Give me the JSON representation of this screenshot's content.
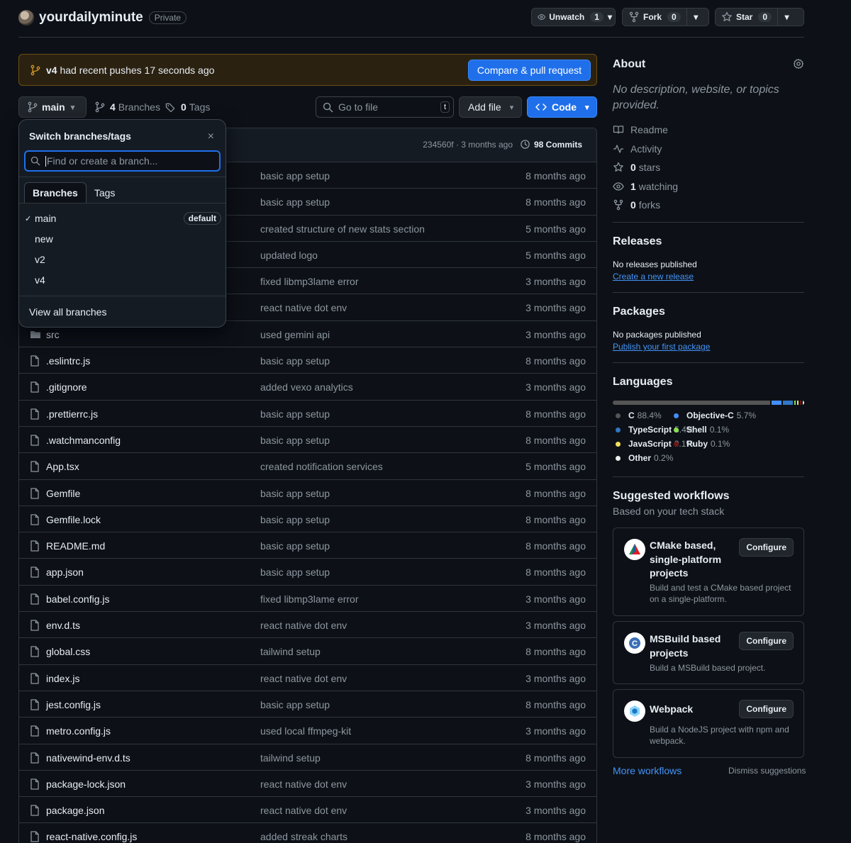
{
  "repo": {
    "owner_name": "yourdailyminute",
    "visibility": "Private"
  },
  "header_actions": {
    "watch": {
      "label": "Unwatch",
      "count": "1"
    },
    "fork": {
      "label": "Fork",
      "count": "0"
    },
    "star": {
      "label": "Star",
      "count": "0"
    }
  },
  "banner": {
    "branch": "v4",
    "text": " had recent pushes 17 seconds ago",
    "button": "Compare & pull request"
  },
  "toolbar": {
    "branch": "main",
    "branches_count": "4",
    "branches_label": "Branches",
    "tags_count": "0",
    "tags_label": "Tags",
    "goto_placeholder": "Go to file",
    "goto_key": "t",
    "add_file": "Add file",
    "code": "Code"
  },
  "latest_commit": {
    "sha_time": "234560f · 3 months ago",
    "commits": "98 Commits"
  },
  "files": [
    {
      "type": "dir",
      "name": "",
      "message": "basic app setup",
      "age": "8 months ago"
    },
    {
      "type": "dir",
      "name": "",
      "message": "basic app setup",
      "age": "8 months ago"
    },
    {
      "type": "dir",
      "name": "",
      "message": "created structure of new stats section",
      "age": "5 months ago"
    },
    {
      "type": "dir",
      "name": "",
      "message": "updated logo",
      "age": "5 months ago"
    },
    {
      "type": "dir",
      "name": "",
      "message": "fixed libmp3lame error",
      "age": "3 months ago"
    },
    {
      "type": "dir",
      "name": "",
      "message": "react native dot env",
      "age": "3 months ago"
    },
    {
      "type": "dir",
      "name": "src",
      "message": "used gemini api",
      "age": "3 months ago"
    },
    {
      "type": "file",
      "name": ".eslintrc.js",
      "message": "basic app setup",
      "age": "8 months ago"
    },
    {
      "type": "file",
      "name": ".gitignore",
      "message": "added vexo analytics",
      "age": "3 months ago"
    },
    {
      "type": "file",
      "name": ".prettierrc.js",
      "message": "basic app setup",
      "age": "8 months ago"
    },
    {
      "type": "file",
      "name": ".watchmanconfig",
      "message": "basic app setup",
      "age": "8 months ago"
    },
    {
      "type": "file",
      "name": "App.tsx",
      "message": "created notification services",
      "age": "5 months ago"
    },
    {
      "type": "file",
      "name": "Gemfile",
      "message": "basic app setup",
      "age": "8 months ago"
    },
    {
      "type": "file",
      "name": "Gemfile.lock",
      "message": "basic app setup",
      "age": "8 months ago"
    },
    {
      "type": "file",
      "name": "README.md",
      "message": "basic app setup",
      "age": "8 months ago"
    },
    {
      "type": "file",
      "name": "app.json",
      "message": "basic app setup",
      "age": "8 months ago"
    },
    {
      "type": "file",
      "name": "babel.config.js",
      "message": "fixed libmp3lame error",
      "age": "3 months ago"
    },
    {
      "type": "file",
      "name": "env.d.ts",
      "message": "react native dot env",
      "age": "3 months ago"
    },
    {
      "type": "file",
      "name": "global.css",
      "message": "tailwind setup",
      "age": "8 months ago"
    },
    {
      "type": "file",
      "name": "index.js",
      "message": "react native dot env",
      "age": "3 months ago"
    },
    {
      "type": "file",
      "name": "jest.config.js",
      "message": "basic app setup",
      "age": "8 months ago"
    },
    {
      "type": "file",
      "name": "metro.config.js",
      "message": "used local ffmpeg-kit",
      "age": "3 months ago"
    },
    {
      "type": "file",
      "name": "nativewind-env.d.ts",
      "message": "tailwind setup",
      "age": "8 months ago"
    },
    {
      "type": "file",
      "name": "package-lock.json",
      "message": "react native dot env",
      "age": "3 months ago"
    },
    {
      "type": "file",
      "name": "package.json",
      "message": "react native dot env",
      "age": "3 months ago"
    },
    {
      "type": "file",
      "name": "react-native.config.js",
      "message": "added streak charts",
      "age": "8 months ago"
    }
  ],
  "branch_dropdown": {
    "title": "Switch branches/tags",
    "close": "×",
    "placeholder": "Find or create a branch...",
    "tabs": [
      "Branches",
      "Tags"
    ],
    "branches": [
      {
        "name": "main",
        "checked": true,
        "badge": "default"
      },
      {
        "name": "new"
      },
      {
        "name": "v2"
      },
      {
        "name": "v4"
      }
    ],
    "footer": "View all branches"
  },
  "about": {
    "title": "About",
    "description": "No description, website, or topics provided.",
    "readme": "Readme",
    "activity": "Activity",
    "stars_count": "0",
    "stars_label": "stars",
    "watching_count": "1",
    "watching_label": "watching",
    "forks_count": "0",
    "forks_label": "forks"
  },
  "releases": {
    "title": "Releases",
    "none": "No releases published",
    "link": "Create a new release"
  },
  "packages": {
    "title": "Packages",
    "none": "No packages published",
    "link": "Publish your first package"
  },
  "languages": {
    "title": "Languages",
    "items": [
      {
        "name": "C",
        "percent": "88.4%",
        "value": 88.4,
        "color": "#555555"
      },
      {
        "name": "Objective-C",
        "percent": "5.7%",
        "value": 5.7,
        "color": "#438eff"
      },
      {
        "name": "TypeScript",
        "percent": "5.4%",
        "value": 5.4,
        "color": "#3178c6"
      },
      {
        "name": "Shell",
        "percent": "0.1%",
        "value": 0.1,
        "color": "#89e051"
      },
      {
        "name": "JavaScript",
        "percent": "0.1%",
        "value": 0.1,
        "color": "#f1e05a"
      },
      {
        "name": "Ruby",
        "percent": "0.1%",
        "value": 0.1,
        "color": "#701516"
      },
      {
        "name": "Other",
        "percent": "0.2%",
        "value": 0.2,
        "color": "#ededed"
      }
    ]
  },
  "workflows": {
    "title": "Suggested workflows",
    "subtitle": "Based on your tech stack",
    "items": [
      {
        "title": "CMake based, single-platform projects",
        "desc": "Build and test a CMake based project on a single-platform.",
        "button": "Configure"
      },
      {
        "title": "MSBuild based projects",
        "desc": "Build a MSBuild based project.",
        "button": "Configure"
      },
      {
        "title": "Webpack",
        "desc": "Build a NodeJS project with npm and webpack.",
        "button": "Configure"
      }
    ],
    "more": "More workflows",
    "dismiss": "Dismiss suggestions"
  }
}
